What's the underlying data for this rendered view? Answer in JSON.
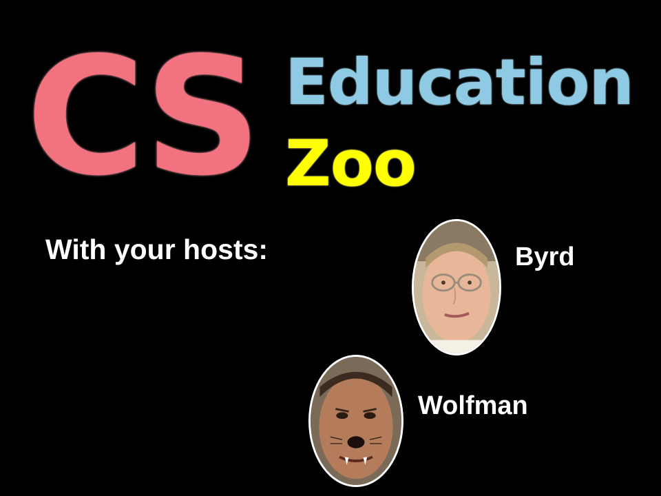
{
  "logo": {
    "cs": "CS",
    "education": "Education",
    "zoo": "Zoo"
  },
  "hosts_heading": "With your hosts:",
  "hosts": [
    {
      "name": "Byrd"
    },
    {
      "name": "Wolfman"
    }
  ],
  "colors": {
    "background": "#000000",
    "cs": "#f2727f",
    "education": "#8ecae3",
    "zoo": "#ffff00",
    "text": "#ffffff"
  }
}
